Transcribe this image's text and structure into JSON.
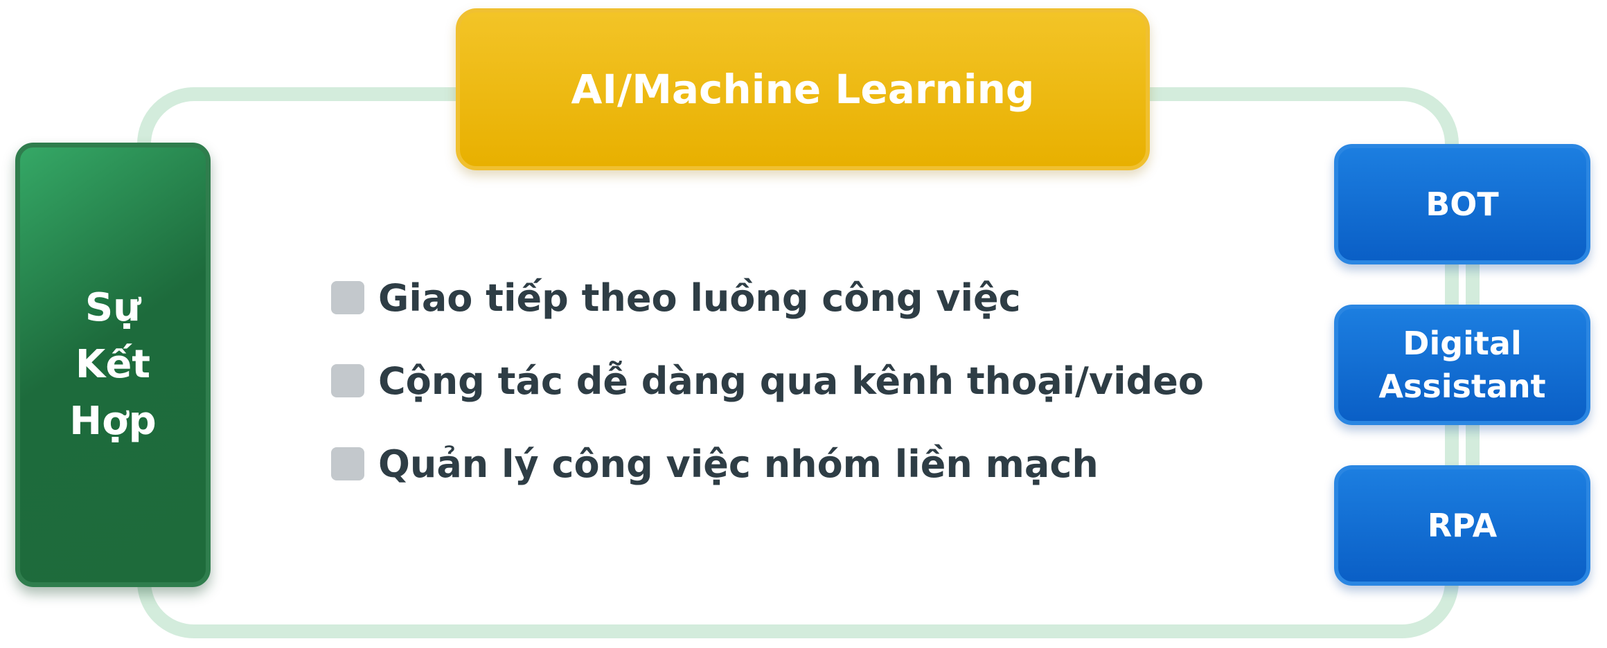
{
  "diagram": {
    "top_box": {
      "label": "AI/Machine Learning"
    },
    "left_box": {
      "lines": [
        "Sự",
        "Kết",
        "Hợp"
      ]
    },
    "right_boxes": [
      {
        "label": "BOT"
      },
      {
        "label_lines": [
          "Digital",
          "Assistant"
        ]
      },
      {
        "label": "RPA"
      }
    ],
    "features": [
      "Giao tiếp theo luồng công việc",
      "Cộng tác dễ dàng qua kênh thoại/video",
      "Quản lý công việc nhóm liền mạch"
    ],
    "colors": {
      "frame": "#d3ecdc",
      "ai_box": "#e8b000",
      "green_box": "#1e6b3b",
      "blue_box": "#0a5fc6",
      "feature_text": "#2e3d45",
      "checkbox": "#c3c8cc"
    }
  }
}
